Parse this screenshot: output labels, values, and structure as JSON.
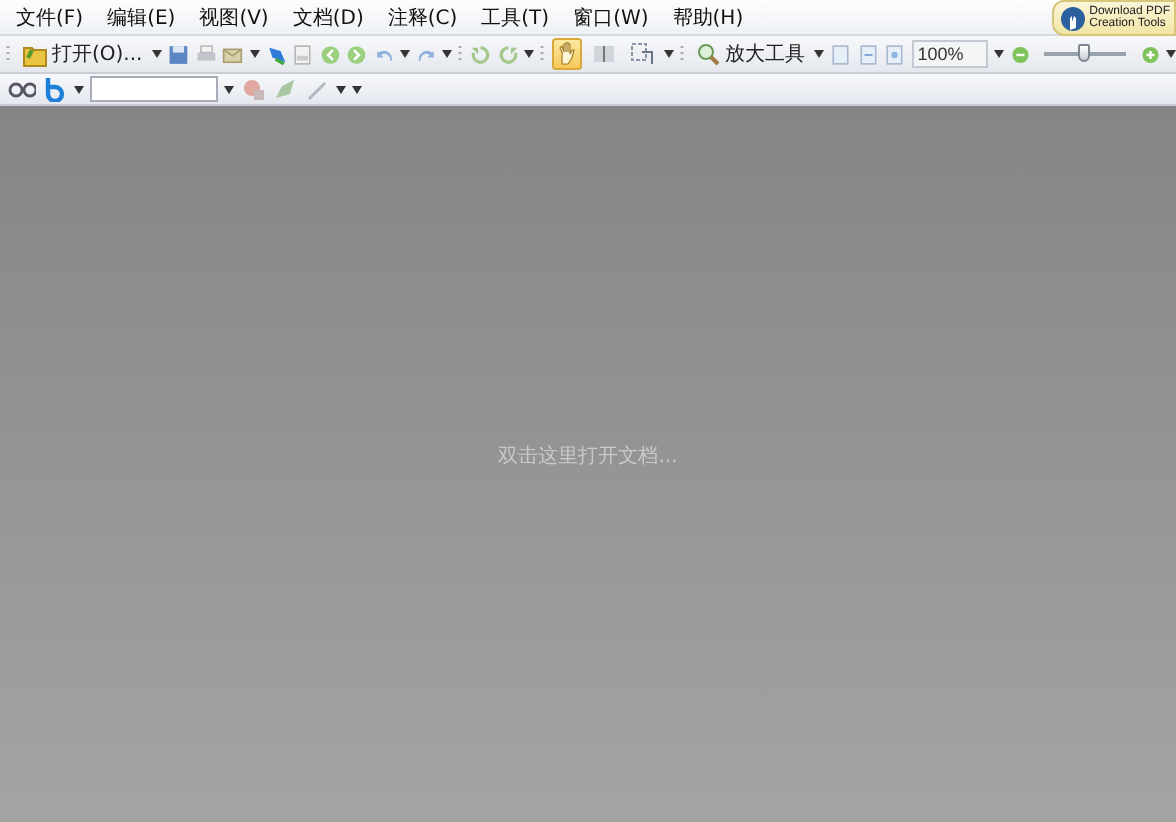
{
  "menu": [
    "文件(F)",
    "编辑(E)",
    "视图(V)",
    "文档(D)",
    "注释(C)",
    "工具(T)",
    "窗口(W)",
    "帮助(H)"
  ],
  "promo": {
    "line_1": "Download PDF",
    "line_2": "Creation Tools"
  },
  "toolbar": {
    "open_button": "打开(O)...",
    "tools": [
      {
        "kind": "hand",
        "selected": true
      },
      {
        "kind": "select",
        "selected": false
      },
      {
        "kind": "snapshot",
        "selected": false
      }
    ],
    "zoom_tool": "放大工具",
    "zoom_value": "100%",
    "zoom_slider": {
      "level": 0.5
    }
  },
  "workspace": {
    "hint": "双击这里打开文档..."
  }
}
